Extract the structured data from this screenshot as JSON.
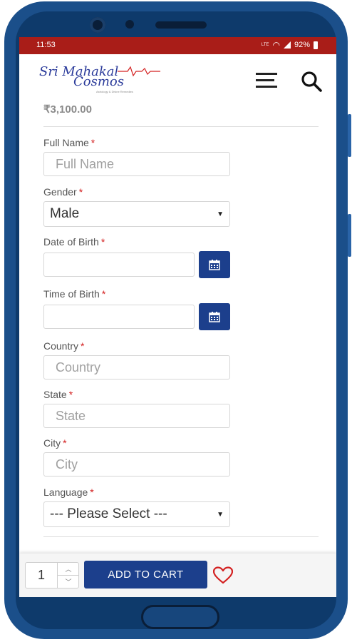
{
  "status_bar": {
    "time": "11:53",
    "network_label": "LTE",
    "battery": "92%"
  },
  "header": {
    "logo_line1": "Sri Mahakal",
    "logo_line2": "Cosmos",
    "logo_tagline": "Astrology & Divine Remedies"
  },
  "product": {
    "price": "₹3,100.00"
  },
  "form": {
    "full_name": {
      "label": "Full Name",
      "placeholder": "Full Name",
      "required": "*"
    },
    "gender": {
      "label": "Gender",
      "value": "Male",
      "required": "*"
    },
    "dob": {
      "label": "Date of Birth",
      "required": "*"
    },
    "tob": {
      "label": "Time of Birth",
      "required": "*"
    },
    "country": {
      "label": "Country",
      "placeholder": "Country",
      "required": "*"
    },
    "state": {
      "label": "State",
      "placeholder": "State",
      "required": "*"
    },
    "city": {
      "label": "City",
      "placeholder": "City",
      "required": "*"
    },
    "language": {
      "label": "Language",
      "value": "--- Please Select ---",
      "required": "*"
    }
  },
  "cart": {
    "quantity": "1",
    "add_label": "ADD TO CART"
  },
  "icons": {
    "menu": "hamburger-icon",
    "search": "search-icon",
    "calendar": "calendar-icon",
    "wishlist": "heart-icon"
  },
  "colors": {
    "status_bar": "#a91d18",
    "primary": "#1c3f8c",
    "required": "#d32020",
    "heart": "#d32020"
  }
}
